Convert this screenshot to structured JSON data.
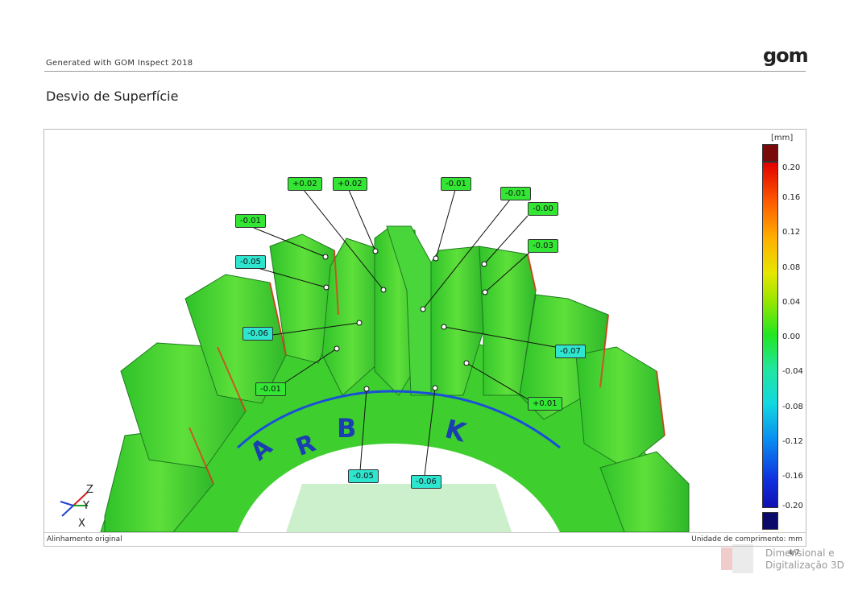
{
  "header": {
    "generated": "Generated with GOM Inspect 2018",
    "logo": "gom"
  },
  "page": {
    "title": "Desvio de Superfície",
    "page_number": "4/7"
  },
  "viewer": {
    "status_left": "Alinhamento original",
    "status_right": "Unidade de comprimento: mm",
    "axes": {
      "z": "Z",
      "y": "Y",
      "x": "X"
    }
  },
  "colorscale": {
    "unit": "[mm]",
    "ticks": [
      "0.20",
      "0.16",
      "0.12",
      "0.08",
      "0.04",
      "0.00",
      "-0.04",
      "-0.08",
      "-0.12",
      "-0.16",
      "-0.20"
    ]
  },
  "deviation_labels": [
    {
      "value": "+0.02",
      "kind": "green"
    },
    {
      "value": "+0.02",
      "kind": "green"
    },
    {
      "value": "-0.01",
      "kind": "green"
    },
    {
      "value": "-0.01",
      "kind": "green"
    },
    {
      "value": "-0.00",
      "kind": "green"
    },
    {
      "value": "-0.01",
      "kind": "green"
    },
    {
      "value": "-0.05",
      "kind": "cyan"
    },
    {
      "value": "-0.03",
      "kind": "green"
    },
    {
      "value": "-0.06",
      "kind": "cyan"
    },
    {
      "value": "-0.07",
      "kind": "cyan"
    },
    {
      "value": "-0.01",
      "kind": "green"
    },
    {
      "value": "+0.01",
      "kind": "green"
    },
    {
      "value": "-0.05",
      "kind": "cyan"
    },
    {
      "value": "-0.06",
      "kind": "cyan"
    }
  ],
  "gear_lettering": [
    "A",
    "R",
    "B",
    "K"
  ],
  "watermark": {
    "line1": "Dimensional e",
    "line2": "Digitalização 3D"
  },
  "colors": {
    "green_label": "#33e633",
    "cyan_label": "#2ee5cf",
    "gear_green": "#3ecf2e"
  }
}
